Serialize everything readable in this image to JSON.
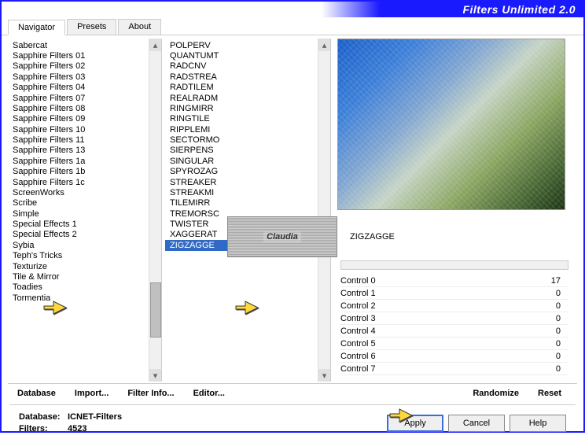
{
  "titlebar": "Filters Unlimited 2.0",
  "tabs": [
    {
      "label": "Navigator",
      "active": true
    },
    {
      "label": "Presets",
      "active": false
    },
    {
      "label": "About",
      "active": false
    }
  ],
  "leftList": [
    "Sabercat",
    "Sapphire Filters 01",
    "Sapphire Filters 02",
    "Sapphire Filters 03",
    "Sapphire Filters 04",
    "Sapphire Filters 07",
    "Sapphire Filters 08",
    "Sapphire Filters 09",
    "Sapphire Filters 10",
    "Sapphire Filters 11",
    "Sapphire Filters 13",
    "Sapphire Filters 1a",
    "Sapphire Filters 1b",
    "Sapphire Filters 1c",
    "ScreenWorks",
    "Scribe",
    "Simple",
    "Special Effects 1",
    "Special Effects 2",
    "Sybia",
    "Teph's Tricks",
    "Texturize",
    "Tile & Mirror",
    "Toadies",
    "Tormentia"
  ],
  "leftSelected": "Sybia",
  "midList": [
    "POLPERV",
    "QUANTUMT",
    "RADCNV",
    "RADSTREA",
    "RADTILEM",
    "REALRADM",
    "RINGMIRR",
    "RINGTILE",
    "RIPPLEMI",
    "SECTORMO",
    "SIERPENS",
    "SINGULAR",
    "SPYROZAG",
    "STREAKER",
    "STREAKMI",
    "TILEMIRR",
    "TREMORSC",
    "TWISTER",
    "XAGGERAT",
    "ZIGZAGGE"
  ],
  "midSelected": "ZIGZAGGE",
  "logoText": "Claudia",
  "currentFilter": "ZIGZAGGE",
  "controls": [
    {
      "name": "Control 0",
      "value": "17"
    },
    {
      "name": "Control 1",
      "value": "0"
    },
    {
      "name": "Control 2",
      "value": "0"
    },
    {
      "name": "Control 3",
      "value": "0"
    },
    {
      "name": "Control 4",
      "value": "0"
    },
    {
      "name": "Control 5",
      "value": "0"
    },
    {
      "name": "Control 6",
      "value": "0"
    },
    {
      "name": "Control 7",
      "value": "0"
    }
  ],
  "middleLinks": {
    "database": "Database",
    "import": "Import...",
    "filterInfo": "Filter Info...",
    "editor": "Editor...",
    "randomize": "Randomize",
    "reset": "Reset"
  },
  "db": {
    "labelDb": "Database:",
    "valueDb": "ICNET-Filters",
    "labelFilters": "Filters:",
    "valueFilters": "4523"
  },
  "buttons": {
    "apply": "Apply",
    "cancel": "Cancel",
    "help": "Help"
  }
}
